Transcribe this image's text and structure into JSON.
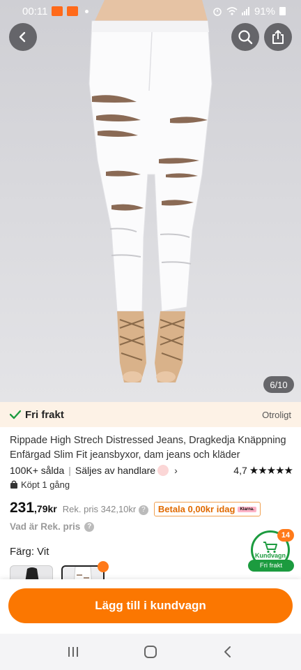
{
  "status_bar": {
    "time": "00:11",
    "battery": "91%",
    "app_badge": "SALE TEMU"
  },
  "header": {
    "back_icon": "chevron-left-icon",
    "search_icon": "search-icon",
    "share_icon": "share-icon"
  },
  "gallery": {
    "pager": "6/10",
    "current": 6,
    "total": 10
  },
  "shipping": {
    "label": "Fri frakt",
    "right_text": "Otroligt"
  },
  "product": {
    "title": "Rippade High Strech Distressed Jeans, Dragkedja Knäppning Enfärgad Slim Fit jeansbyxor, dam jeans och kläder",
    "sold": "100K+ sålda",
    "seller": "Säljes av handlare",
    "rating": "4,7",
    "rating_value": 4.7,
    "bought": "Köpt 1 gång",
    "price_int": "231",
    "price_dec": ",79kr",
    "rek_price": "Rek. pris 342,10kr",
    "klarna_text": "Betala 0,00kr idag",
    "klarna_logo": "Klarna.",
    "rek_question": "Vad är Rek. pris",
    "color_label": "Färg: Vit"
  },
  "cart": {
    "count": "14",
    "label": "Kundvagn",
    "free": "Fri frakt"
  },
  "actions": {
    "add_to_cart": "Lägg till i kundvagn"
  },
  "colors": {
    "accent": "#fb7701",
    "green": "#1c9b3f",
    "ship_bg": "#fdf2e6"
  }
}
